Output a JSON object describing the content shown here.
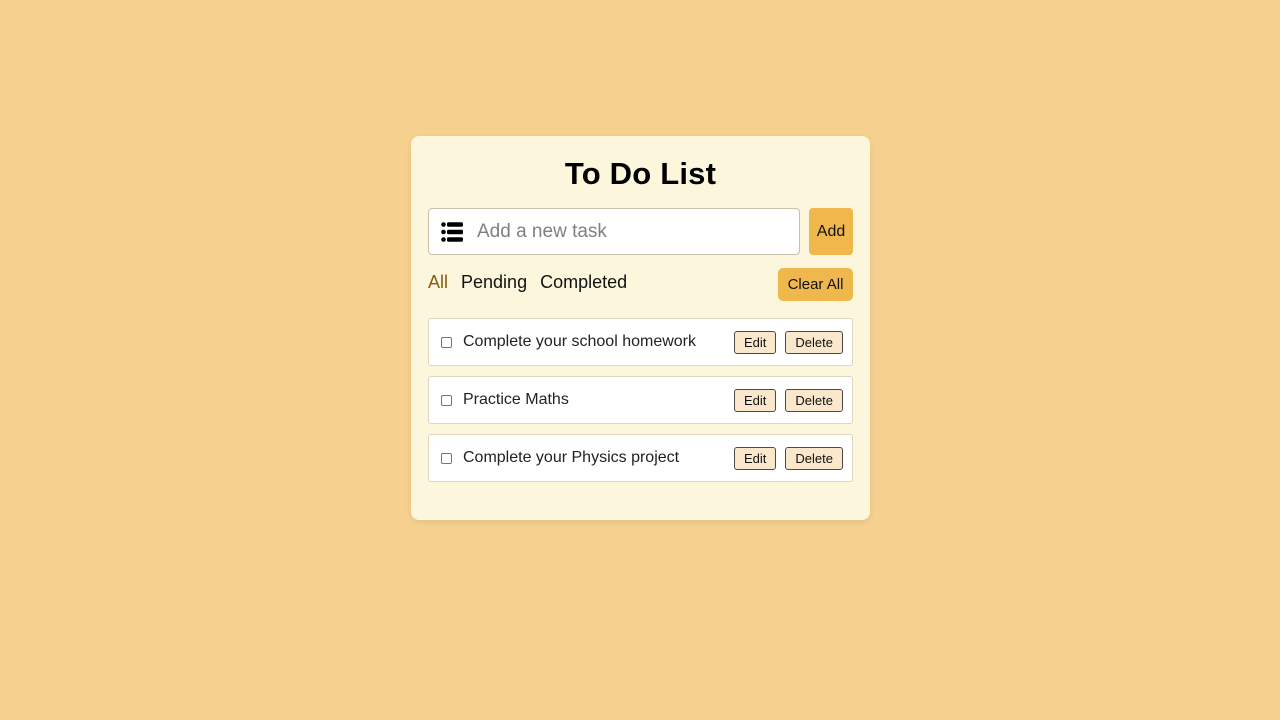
{
  "app": {
    "title": "To Do List"
  },
  "input": {
    "placeholder": "Add a new task",
    "value": "",
    "add_label": "Add",
    "icon": "list-icon"
  },
  "filters": {
    "items": [
      "All",
      "Pending",
      "Completed"
    ],
    "active": "All",
    "clear_label": "Clear All"
  },
  "tasks": [
    {
      "text": "Complete your school homework",
      "done": false,
      "edit_label": "Edit",
      "delete_label": "Delete"
    },
    {
      "text": "Practice Maths",
      "done": false,
      "edit_label": "Edit",
      "delete_label": "Delete"
    },
    {
      "text": "Complete your Physics project",
      "done": false,
      "edit_label": "Edit",
      "delete_label": "Delete"
    }
  ],
  "colors": {
    "background": "#f5d08f",
    "card": "#fcf6dc",
    "accent": "#f0b84c",
    "active_filter": "#8a5b12",
    "task_button": "#fbe8cc"
  }
}
